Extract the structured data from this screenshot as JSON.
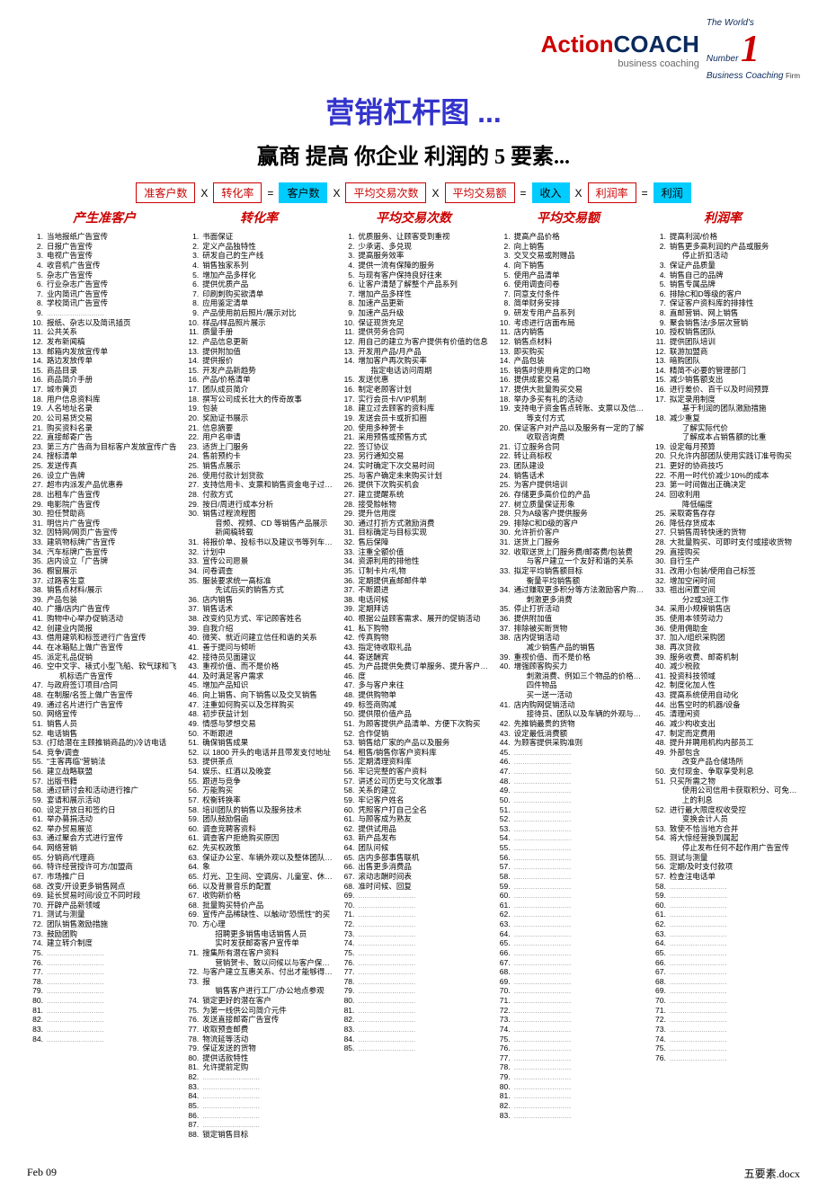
{
  "logo": {
    "action": "Action",
    "coach": "COACH",
    "sub": "business coaching",
    "worlds": "The World's",
    "number": "Number",
    "one": "1",
    "bc2": "Business Coaching",
    "firm": "Firm"
  },
  "title": "营销杠杆图 ...",
  "subtitle": "赢商 提高 你企业 利润的 5 要素...",
  "formula": [
    {
      "type": "box",
      "cls": "",
      "text": "准客户数"
    },
    {
      "type": "op",
      "text": "X"
    },
    {
      "type": "box",
      "cls": "",
      "text": "转化率"
    },
    {
      "type": "op",
      "text": "="
    },
    {
      "type": "box",
      "cls": "blue",
      "text": "客户数"
    },
    {
      "type": "op",
      "text": "X"
    },
    {
      "type": "box",
      "cls": "",
      "text": "平均交易次数"
    },
    {
      "type": "op",
      "text": "X"
    },
    {
      "type": "box",
      "cls": "",
      "text": "平均交易额"
    },
    {
      "type": "op",
      "text": "="
    },
    {
      "type": "box",
      "cls": "blue",
      "text": "收入"
    },
    {
      "type": "op",
      "text": "X"
    },
    {
      "type": "box",
      "cls": "",
      "text": "利润率"
    },
    {
      "type": "op",
      "text": "="
    },
    {
      "type": "box",
      "cls": "blue",
      "text": "利润"
    }
  ],
  "headers": [
    "产生准客户",
    "转化率",
    "平均交易次数",
    "平均交易额",
    "利润率"
  ],
  "col1": [
    {
      "t": "当地报纸广告宣传"
    },
    {
      "t": "日报广告宣传"
    },
    {
      "t": "电视广告宣传"
    },
    {
      "t": "收音机广告宣传"
    },
    {
      "t": "杂志广告宣传"
    },
    {
      "t": "行业杂志广告宣传"
    },
    {
      "t": "业内简讯广告宣传"
    },
    {
      "t": "学校简讯广告宣传"
    },
    {
      "t": "",
      "blank": true
    },
    {
      "t": "报纸、杂志以及简讯插页"
    },
    {
      "t": "公共关系"
    },
    {
      "t": "发布新闻稿"
    },
    {
      "t": "邮箱内发放宣传单"
    },
    {
      "t": "路边发放传单"
    },
    {
      "t": "商品目录"
    },
    {
      "t": "商品简介手册"
    },
    {
      "t": "城市黄页"
    },
    {
      "t": "用户信息资料库"
    },
    {
      "t": "人名地址名录"
    },
    {
      "t": "公司易货交易"
    },
    {
      "t": "购买资料名录"
    },
    {
      "t": "直接邮寄广告"
    },
    {
      "t": "第三方广告商为目标客户发放宣传广告"
    },
    {
      "t": "搜标清单"
    },
    {
      "t": "发送传真"
    },
    {
      "t": "设立广告牌"
    },
    {
      "t": "超市内派发产品优惠券"
    },
    {
      "t": "出租车广告宣传"
    },
    {
      "t": "电影院广告宣传"
    },
    {
      "t": "担任赞助商"
    },
    {
      "t": "明信片广告宣传"
    },
    {
      "t": "因特网/网页广告宣传"
    },
    {
      "t": "建筑物标牌广告宣传"
    },
    {
      "t": "汽车标牌广告宣传"
    },
    {
      "t": "店内设立「广告牌"
    },
    {
      "t": "橱窗展示"
    },
    {
      "t": "过路客生意"
    },
    {
      "t": "销售点材料/展示"
    },
    {
      "t": "产品包装"
    },
    {
      "t": "广播/店内广告宣传"
    },
    {
      "t": "购物中心举办促销活动"
    },
    {
      "t": "创建业内简报"
    },
    {
      "t": "借用建筑和标签进行广告宣传"
    },
    {
      "t": "在冰箱贴上做广告宣传"
    },
    {
      "t": "派定礼品促销"
    },
    {
      "t": "空中文字、裱式小型飞船、软气球和飞"
    },
    {
      "t": "机标语广告宣传",
      "sub": true
    },
    {
      "t": "与政府签订项目/合同"
    },
    {
      "t": "在制服/名签上做广告宣传"
    },
    {
      "t": "通过名片进行广告宣传"
    },
    {
      "t": "网络宣传"
    },
    {
      "t": "销售人员"
    },
    {
      "t": "电话销售"
    },
    {
      "t": "(打给潜在主顾推销商品的)冷访电话"
    },
    {
      "t": "竞争/调查"
    },
    {
      "t": "\"主客再临\"营销法"
    },
    {
      "t": "建立战略联盟"
    },
    {
      "t": "出版书籍"
    },
    {
      "t": "通过研讨会和活动进行推广"
    },
    {
      "t": "宴请和展示活动"
    },
    {
      "t": "设定开放日和签约日"
    },
    {
      "t": "举办募捐活动"
    },
    {
      "t": "举办贸易展览"
    },
    {
      "t": "通过聚会方式进行宣传"
    },
    {
      "t": "网络营销"
    },
    {
      "t": "分销商/代理商"
    },
    {
      "t": "特许经营授许可方/加盟商"
    },
    {
      "t": "市场推广日"
    },
    {
      "t": "改变/开设更多销售网点"
    },
    {
      "t": "延长贸易时间/设立不同时段"
    },
    {
      "t": "开辟产品新领域"
    },
    {
      "t": "测试与测量"
    },
    {
      "t": "团队销售激励措施"
    },
    {
      "t": "鼓励团购"
    },
    {
      "t": "建立转介制度"
    },
    {
      "t": "",
      "blank": true
    },
    {
      "t": "",
      "blank": true
    },
    {
      "t": "",
      "blank": true
    },
    {
      "t": "",
      "blank": true
    },
    {
      "t": "",
      "blank": true
    },
    {
      "t": "",
      "blank": true
    },
    {
      "t": "",
      "blank": true
    },
    {
      "t": "",
      "blank": true
    },
    {
      "t": "",
      "blank": true
    },
    {
      "t": "",
      "blank": true
    }
  ],
  "col2": [
    {
      "t": "书面保证"
    },
    {
      "t": "定义产品独特性"
    },
    {
      "t": "研发自己的生产线"
    },
    {
      "t": "销售独家系列"
    },
    {
      "t": "增加产品多样化"
    },
    {
      "t": "提供优质产品"
    },
    {
      "t": "印刷刺购买欲清单"
    },
    {
      "t": "应用鉴定清单"
    },
    {
      "t": "产品使用前后照片/展示对比"
    },
    {
      "t": "样品/样品照片展示"
    },
    {
      "t": "质量手册"
    },
    {
      "t": "产品信息更新"
    },
    {
      "t": "提供附加值"
    },
    {
      "t": "提供报价"
    },
    {
      "t": "开发产品新趋势"
    },
    {
      "t": "产品/价格清单"
    },
    {
      "t": "团队成员简介"
    },
    {
      "t": "撰写公司成长壮大的传奇故事"
    },
    {
      "t": "包装"
    },
    {
      "t": "奖励证书展示"
    },
    {
      "t": "信息摘要"
    },
    {
      "t": "用户名申请"
    },
    {
      "t": "适货上门服务"
    },
    {
      "t": "售前预约卡"
    },
    {
      "t": "销售点展示"
    },
    {
      "t": "使用付款计划贷款"
    },
    {
      "t": "支持信用卡、支票和销售资金电子过户等"
    },
    {
      "t": "付款方式"
    },
    {
      "t": "按日/周进行成本分析"
    },
    {
      "t": "销售过程流程图"
    },
    {
      "t": "音频、视频、CD 等销售产品展示",
      "sub": true
    },
    {
      "t": "新闻稿转载",
      "sub": true
    },
    {
      "t": "将报价单、投标书以及建议书等列车行动"
    },
    {
      "t": "计划中"
    },
    {
      "t": "宣传公司愿景"
    },
    {
      "t": "问卷调查"
    },
    {
      "t": "服装要求统一高标准"
    },
    {
      "t": "先试后买的销售方式",
      "sub": true
    },
    {
      "t": "店内销售"
    },
    {
      "t": "销售话术"
    },
    {
      "t": "改变约见方式、牢记顾客姓名"
    },
    {
      "t": "自我介绍"
    },
    {
      "t": "微笑、就近问建立信任和谐的关系"
    },
    {
      "t": "善于提问与倾听"
    },
    {
      "t": "接待员见面建议"
    },
    {
      "t": "重视价值、而不是价格"
    },
    {
      "t": "及时满足客户需求"
    },
    {
      "t": "增加产品知识"
    },
    {
      "t": "向上销售、向下销售以及交叉销售"
    },
    {
      "t": "注重如何购买以及怎样购买"
    },
    {
      "t": "初步获益计划"
    },
    {
      "t": "情感与梦想交易"
    },
    {
      "t": "不断跟进"
    },
    {
      "t": "确保销售成果"
    },
    {
      "t": "以 1800 开头的电话并且带发支付地址"
    },
    {
      "t": "提供茶点"
    },
    {
      "t": "娱乐、红酒以及晚宴"
    },
    {
      "t": "跟进与竞争"
    },
    {
      "t": "万能购买"
    },
    {
      "t": "权衡转换率"
    },
    {
      "t": "培训团队的销售以及服务技术"
    },
    {
      "t": "团队鼓励倡函"
    },
    {
      "t": "调查竞聘客资料"
    },
    {
      "t": "调查客户拒绝购买原因"
    },
    {
      "t": "先买权政策"
    },
    {
      "t": "保证办公室、车辆外观以及整体团队的形"
    },
    {
      "t": "象"
    },
    {
      "t": "灯光、卫生间、空调房、儿童室、休息室"
    },
    {
      "t": "以及背景音乐的配置"
    },
    {
      "t": "收购新价格"
    },
    {
      "t": "批量购买特价产品"
    },
    {
      "t": "宣传产品稀缺性、以触动\"恐慌性\"的买"
    },
    {
      "t": "方心理"
    },
    {
      "t": "招聘更多销售电话销售人员",
      "sub": true
    },
    {
      "t": "实时发获邮寄客户宣传单",
      "sub": true
    },
    {
      "t": "搜集所有潜在客户资料"
    },
    {
      "t": "营销贺卡、致以问候以与客户保持联系",
      "sub": true
    },
    {
      "t": "与客户建立互惠关系、付出才能够得到回"
    },
    {
      "t": "报"
    },
    {
      "t": "销售客户进行工厂/办公地点参观",
      "sub": true
    },
    {
      "t": "锁定更好的潜在客户"
    },
    {
      "t": "为第一线供公司简介元件"
    },
    {
      "t": "发送直接邮寄广告宣传"
    },
    {
      "t": "收取预查邮费"
    },
    {
      "t": "物流延等活动"
    },
    {
      "t": "保证发送的货物"
    },
    {
      "t": "提供话款特性"
    },
    {
      "t": "允许提前定购"
    },
    {
      "t": "",
      "blank": true
    },
    {
      "t": "",
      "blank": true
    },
    {
      "t": "",
      "blank": true
    },
    {
      "t": "",
      "blank": true
    },
    {
      "t": "",
      "blank": true
    },
    {
      "t": "",
      "blank": true
    },
    {
      "t": "锁定销售目标"
    }
  ],
  "col3": [
    {
      "t": "优质服务、让顾客受到重视"
    },
    {
      "t": "少承诺、多兑现"
    },
    {
      "t": "提高服务效率"
    },
    {
      "t": "提供一流有保障的服务"
    },
    {
      "t": "与现有客户保持良好往来"
    },
    {
      "t": "让客户清楚了解整个产品系列"
    },
    {
      "t": "增加产品多样性"
    },
    {
      "t": "加速产品更新"
    },
    {
      "t": "加速产品升级"
    },
    {
      "t": "保证现货充足"
    },
    {
      "t": "提供劳务合同"
    },
    {
      "t": "用自己的建立为客户提供有价值的信息"
    },
    {
      "t": "开发用产品/月产品"
    },
    {
      "t": "增加客户再次购买率"
    },
    {
      "t": "指定电话访问周期",
      "sub": true
    },
    {
      "t": "发送优惠"
    },
    {
      "t": "制定老顾客计划"
    },
    {
      "t": "实行会员卡/VIP机制"
    },
    {
      "t": "建立过去顾客的资料库"
    },
    {
      "t": "发送会员卡或折扣圈"
    },
    {
      "t": "使用多种贺卡"
    },
    {
      "t": "采用预售或预售方式"
    },
    {
      "t": "签订协议"
    },
    {
      "t": "另行通知交易"
    },
    {
      "t": "实时确定下次交易时间"
    },
    {
      "t": "与客户确定未来购买计划"
    },
    {
      "t": "提供下次购买机会"
    },
    {
      "t": "建立提醒系统"
    },
    {
      "t": "接受赊帐物"
    },
    {
      "t": "提升信用度"
    },
    {
      "t": "通过打折方式激励消费"
    },
    {
      "t": "目标确定与目标实现"
    },
    {
      "t": "售后保障"
    },
    {
      "t": "注重全额价值"
    },
    {
      "t": "资源利用的排他性"
    },
    {
      "t": "订制卡片/礼物"
    },
    {
      "t": "定期提供直邮邮件单"
    },
    {
      "t": "不断跟进"
    },
    {
      "t": "电话问候"
    },
    {
      "t": "定期拜访"
    },
    {
      "t": "根据公益顾客需求、展开的促销活动"
    },
    {
      "t": "私下购物"
    },
    {
      "t": "传真购物"
    },
    {
      "t": "指定待收取礼品"
    },
    {
      "t": "寄送酬宾"
    },
    {
      "t": "为产品提供免费订单服务、提升客户忠诚"
    },
    {
      "t": "度"
    },
    {
      "t": "多与客户来往"
    },
    {
      "t": "提供购物单"
    },
    {
      "t": "标签商购减"
    },
    {
      "t": "提供限价值产品"
    },
    {
      "t": "为顾客提供产品清单、方便下次购买"
    },
    {
      "t": "合作促销"
    },
    {
      "t": "销售给厂家的产品以及服务"
    },
    {
      "t": "租售/销售你客户资料库"
    },
    {
      "t": "定期清理资料库"
    },
    {
      "t": "牢记完整的客户资料"
    },
    {
      "t": "讲述公司历史与文化故事"
    },
    {
      "t": "关系的建立"
    },
    {
      "t": "牢记客户姓名"
    },
    {
      "t": "凭照客户打自己全名"
    },
    {
      "t": "与顾客成为熟友"
    },
    {
      "t": "提供试用品"
    },
    {
      "t": "新产品发布"
    },
    {
      "t": "团队问候"
    },
    {
      "t": "店内多部事售联机"
    },
    {
      "t": "出售更多消费品"
    },
    {
      "t": "滚动志酬时间表"
    },
    {
      "t": "准时问候、回复"
    },
    {
      "t": "",
      "blank": true
    },
    {
      "t": "",
      "blank": true
    },
    {
      "t": "",
      "blank": true
    },
    {
      "t": "",
      "blank": true
    },
    {
      "t": "",
      "blank": true
    },
    {
      "t": "",
      "blank": true
    },
    {
      "t": "",
      "blank": true
    },
    {
      "t": "",
      "blank": true
    },
    {
      "t": "",
      "blank": true
    },
    {
      "t": "",
      "blank": true
    },
    {
      "t": "",
      "blank": true
    },
    {
      "t": "",
      "blank": true
    },
    {
      "t": "",
      "blank": true
    },
    {
      "t": "",
      "blank": true
    },
    {
      "t": "",
      "blank": true
    },
    {
      "t": "",
      "blank": true
    },
    {
      "t": "",
      "blank": true
    }
  ],
  "col4": [
    {
      "t": "提高产品价格"
    },
    {
      "t": "向上销售"
    },
    {
      "t": "交叉交易或附赠品"
    },
    {
      "t": "向下销售"
    },
    {
      "t": "使用产品清单"
    },
    {
      "t": "使用调查问卷"
    },
    {
      "t": "同意支付条件"
    },
    {
      "t": "简单财务安排"
    },
    {
      "t": "研发专用产品系列"
    },
    {
      "t": "考虑进行店面布局"
    },
    {
      "t": "店内销售"
    },
    {
      "t": "销售点材料"
    },
    {
      "t": "即买购买"
    },
    {
      "t": "产品包装"
    },
    {
      "t": "销售时使用肯定的口吻"
    },
    {
      "t": "提供成套交易"
    },
    {
      "t": "提供大批量购买交易"
    },
    {
      "t": "举办多买有礼的活动"
    },
    {
      "t": "支持电子资金售点转账、支票以及信用卡"
    },
    {
      "t": "等支付方式",
      "sub": true
    },
    {
      "t": "保证客户对产品以及服务有一定的了解"
    },
    {
      "t": "收取咨询费",
      "sub": true
    },
    {
      "t": "订立服务合同"
    },
    {
      "t": "转让商标权"
    },
    {
      "t": "团队建设"
    },
    {
      "t": "销售话术"
    },
    {
      "t": "为客户提供培训"
    },
    {
      "t": "存储更多高价位的产品"
    },
    {
      "t": "树立质量保证形象"
    },
    {
      "t": "只为A级客户提供服务"
    },
    {
      "t": "排除C和D级的客户"
    },
    {
      "t": "允许折价客户"
    },
    {
      "t": "送货上门服务"
    },
    {
      "t": "收取送货上门服务费/邮寄费/包装费"
    },
    {
      "t": "与客户建立一个友好和谐的关系",
      "sub": true
    },
    {
      "t": "拟定平均销售额目标"
    },
    {
      "t": "衡量平均销售额",
      "sub": true
    },
    {
      "t": "通过赚取更多积分等方法激励客户购买力"
    },
    {
      "t": "刺激更多消费",
      "sub": true
    },
    {
      "t": "停止打折活动"
    },
    {
      "t": "提供附加值"
    },
    {
      "t": "排除被买断货物"
    },
    {
      "t": "店内促销活动"
    },
    {
      "t": "减少销售产品的销售",
      "sub": true
    },
    {
      "t": "重视价值、而不是价格"
    },
    {
      "t": "增强顾客购买力"
    },
    {
      "t": "刺激消费、例如三个物品的价格可以购买",
      "sub": true
    },
    {
      "t": "四件物品",
      "sub": true
    },
    {
      "t": "买一送一活动",
      "sub": true
    },
    {
      "t": "店内购网促销活动"
    },
    {
      "t": "接待员、团队以及车辆的外观与形象",
      "sub": true
    },
    {
      "t": "先推销最贵的货物"
    },
    {
      "t": "设定最低消费额"
    },
    {
      "t": "为顾客提供采购准则"
    },
    {
      "t": "",
      "blank": true
    },
    {
      "t": "",
      "blank": true
    },
    {
      "t": "",
      "blank": true
    },
    {
      "t": "",
      "blank": true
    },
    {
      "t": "",
      "blank": true
    },
    {
      "t": "",
      "blank": true
    },
    {
      "t": "",
      "blank": true
    },
    {
      "t": "",
      "blank": true
    },
    {
      "t": "",
      "blank": true
    },
    {
      "t": "",
      "blank": true
    },
    {
      "t": "",
      "blank": true
    },
    {
      "t": "",
      "blank": true
    },
    {
      "t": "",
      "blank": true
    },
    {
      "t": "",
      "blank": true
    },
    {
      "t": "",
      "blank": true
    },
    {
      "t": "",
      "blank": true
    },
    {
      "t": "",
      "blank": true
    },
    {
      "t": "",
      "blank": true
    },
    {
      "t": "",
      "blank": true
    },
    {
      "t": "",
      "blank": true
    },
    {
      "t": "",
      "blank": true
    },
    {
      "t": "",
      "blank": true
    },
    {
      "t": "",
      "blank": true
    },
    {
      "t": "",
      "blank": true
    },
    {
      "t": "",
      "blank": true
    },
    {
      "t": "",
      "blank": true
    },
    {
      "t": "",
      "blank": true
    },
    {
      "t": "",
      "blank": true
    },
    {
      "t": "",
      "blank": true
    },
    {
      "t": "",
      "blank": true
    },
    {
      "t": "",
      "blank": true
    },
    {
      "t": "",
      "blank": true
    },
    {
      "t": "",
      "blank": true
    },
    {
      "t": "",
      "blank": true
    },
    {
      "t": "",
      "blank": true
    },
    {
      "t": "",
      "blank": true
    },
    {
      "t": "",
      "blank": true
    },
    {
      "t": "",
      "blank": true
    },
    {
      "t": "",
      "blank": true
    }
  ],
  "col5": [
    {
      "t": "提高利润/价格"
    },
    {
      "t": "销售更多高利润的产品或服务"
    },
    {
      "t": "停止折扣活动",
      "sub": true
    },
    {
      "t": "保证产品质量"
    },
    {
      "t": "销售自己的品牌"
    },
    {
      "t": "销售专属品牌"
    },
    {
      "t": "排除C和D等级的客户"
    },
    {
      "t": "保证客户资料库的排排性"
    },
    {
      "t": "直邮营销、网上销售"
    },
    {
      "t": "聚会销售法/多层次营销"
    },
    {
      "t": "授权销售团队"
    },
    {
      "t": "提供团队培训"
    },
    {
      "t": "联游加盟商"
    },
    {
      "t": "暗购团队"
    },
    {
      "t": "精简不必要的管理部门"
    },
    {
      "t": "减少销售额支出"
    },
    {
      "t": "进行差价、百千以及时间预算"
    },
    {
      "t": "拟定录用制度"
    },
    {
      "t": "基于利润的团队激励措施",
      "sub": true
    },
    {
      "t": "减少重复"
    },
    {
      "t": "了解实际代价",
      "sub": true
    },
    {
      "t": "了解成本占销售额的比重",
      "sub": true
    },
    {
      "t": "设定每月预算"
    },
    {
      "t": "只允许内部团队使用实践订准号购买"
    },
    {
      "t": "更好的协商技巧"
    },
    {
      "t": "不用一时代价减少10%的成本"
    },
    {
      "t": "第一时间做出正确决定"
    },
    {
      "t": "回收利用"
    },
    {
      "t": "降低幅度",
      "sub": true
    },
    {
      "t": "采取寄售存存"
    },
    {
      "t": "降低存货成本"
    },
    {
      "t": "只销售周转快速的货物"
    },
    {
      "t": "大批量购买、可即时支付或接收货物"
    },
    {
      "t": "直接购买"
    },
    {
      "t": "自行生产"
    },
    {
      "t": "改用小包装/使用自己标签"
    },
    {
      "t": "增加空闲时间"
    },
    {
      "t": "祖出闲置空间"
    },
    {
      "t": "分2或3班工作",
      "sub": true
    },
    {
      "t": "采用小规模销售店"
    },
    {
      "t": "使用本领劳动力"
    },
    {
      "t": "使用佣助金"
    },
    {
      "t": "加入/组织采购团"
    },
    {
      "t": "再次贷款"
    },
    {
      "t": "服务收费、邮寄机制"
    },
    {
      "t": "减少税款"
    },
    {
      "t": "投资科技领域"
    },
    {
      "t": "制度化加人性"
    },
    {
      "t": "提高系统使用自动化"
    },
    {
      "t": "出售空时的机器/设备"
    },
    {
      "t": "清理闲资"
    },
    {
      "t": "减少构收支出"
    },
    {
      "t": "制定而定费用"
    },
    {
      "t": "提升并聘用机构内部员工"
    },
    {
      "t": "外部包含"
    },
    {
      "t": "改变产品仓储场所",
      "sub": true
    },
    {
      "t": "支付现金、争取享受利息"
    },
    {
      "t": "只买所需之物"
    },
    {
      "t": "使用公司信用卡获取积分、可免除55天以",
      "sub": true
    },
    {
      "t": "上的利息",
      "sub": true
    },
    {
      "t": "进行最大限度权收受控"
    },
    {
      "t": "变换会计人员",
      "sub": true
    },
    {
      "t": "致使不恰当地方合并"
    },
    {
      "t": "将大惊经营换到属起"
    },
    {
      "t": "停止发布任何不起作用广告宣传",
      "sub": true
    },
    {
      "t": "测试与测量"
    },
    {
      "t": "定期/及时支付款项"
    },
    {
      "t": "检查注电话单"
    },
    {
      "t": "",
      "blank": true
    },
    {
      "t": "",
      "blank": true
    },
    {
      "t": "",
      "blank": true
    },
    {
      "t": "",
      "blank": true
    },
    {
      "t": "",
      "blank": true
    },
    {
      "t": "",
      "blank": true
    },
    {
      "t": "",
      "blank": true
    },
    {
      "t": "",
      "blank": true
    },
    {
      "t": "",
      "blank": true
    },
    {
      "t": "",
      "blank": true
    },
    {
      "t": "",
      "blank": true
    },
    {
      "t": "",
      "blank": true
    },
    {
      "t": "",
      "blank": true
    },
    {
      "t": "",
      "blank": true
    },
    {
      "t": "",
      "blank": true
    },
    {
      "t": "",
      "blank": true
    },
    {
      "t": "",
      "blank": true
    },
    {
      "t": "",
      "blank": true
    },
    {
      "t": "",
      "blank": true
    }
  ],
  "footer": {
    "left": "Feb 09",
    "right": "五要素.docx"
  }
}
